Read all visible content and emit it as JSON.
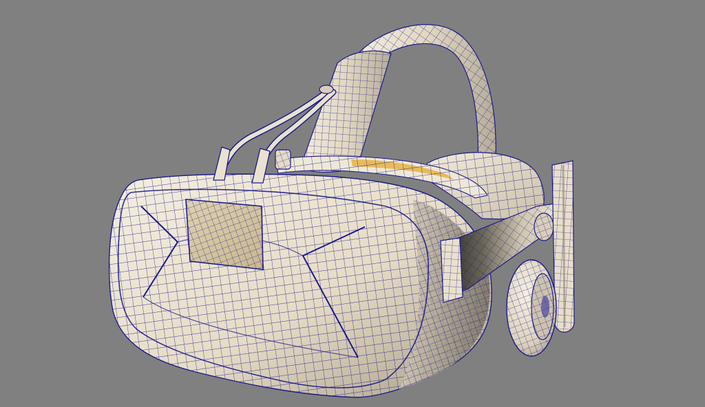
{
  "scene": {
    "subject": "vr-headset-wireframe-model",
    "colors": {
      "background": "#808080",
      "wire": "#1a1a8c",
      "shell_light": "#efe7d6",
      "shell_mid": "#d8ceb8",
      "shell_dark": "#8e8676",
      "shell_shadow": "#3a3833",
      "accent_yellow": "#e8b64a",
      "sensor_panel": "#d9c9a4"
    },
    "components": [
      "front-shell",
      "sensor-panel",
      "cables",
      "top-strap",
      "side-strap",
      "rear-cushion",
      "right-headphone",
      "headphone-arm"
    ]
  }
}
